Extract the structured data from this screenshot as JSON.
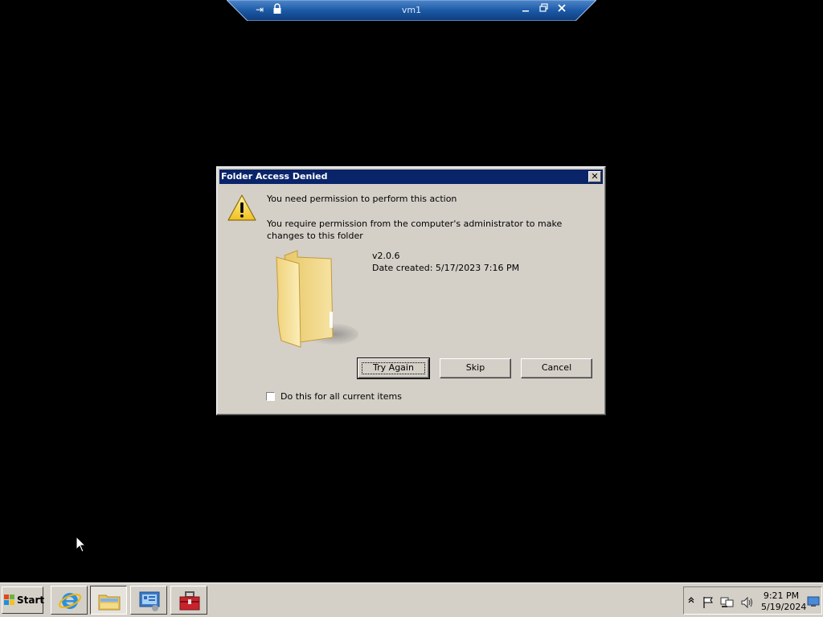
{
  "connection_bar": {
    "title": "vm1",
    "icons": [
      "pin-icon",
      "lock-icon",
      "minimize-icon",
      "restore-icon",
      "close-icon"
    ]
  },
  "dialog": {
    "title": "Folder Access Denied",
    "close_glyph": "✕",
    "heading": "You need permission to perform this action",
    "detail": "You require permission from the computer's administrator to make changes to this folder",
    "item_name": "v2.0.6",
    "item_date": "Date created: 5/17/2023 7:16 PM",
    "buttons": {
      "try_again": "Try Again",
      "skip": "Skip",
      "cancel": "Cancel"
    },
    "checkbox_label": "Do this for all current items",
    "checkbox_checked": false
  },
  "taskbar": {
    "start_label": "Start",
    "apps": [
      "internet-explorer-icon",
      "windows-explorer-icon",
      "server-manager-icon",
      "toolbox-icon"
    ],
    "active_app": "windows-explorer-icon",
    "tray_icons": [
      "show-hidden-icons-icon",
      "action-center-flag-icon",
      "network-icon",
      "volume-icon"
    ],
    "clock_time": "9:21 PM",
    "clock_date": "5/19/2024"
  },
  "colors": {
    "desktop": "#000000",
    "titlebar": "#0a246a",
    "dialog_face": "#d4d0c8",
    "connection_bar": "#1c5aa6"
  }
}
